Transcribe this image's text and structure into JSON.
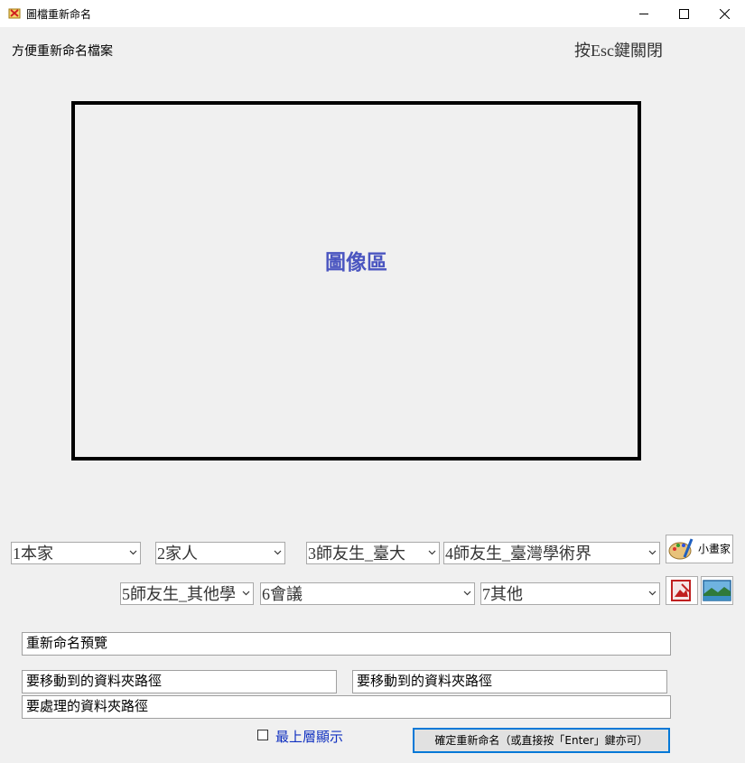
{
  "window": {
    "title": "圖檔重新命名",
    "controls": [
      "minimize-icon",
      "maximize-icon",
      "close-icon"
    ]
  },
  "header": {
    "subtitle": "方便重新命名檔案",
    "esc_hint": "按Esc鍵關閉"
  },
  "image_area": {
    "label": "圖像區"
  },
  "categories": {
    "row1": [
      "1本家",
      "2家人",
      "3師友生_臺大",
      "4師友生_臺灣學術界"
    ],
    "row2": [
      "5師友生_其他學",
      "6會議",
      "7其他"
    ]
  },
  "buttons": {
    "paint_label": "小畫家",
    "confirm_label": "確定重新命名（或直接按「Enter」鍵亦可）"
  },
  "fields": {
    "rename_preview": "重新命名預覽",
    "move_path_1": "要移動到的資料夾路徑",
    "move_path_2": "要移動到的資料夾路徑",
    "process_path": "要處理的資料夾路徑"
  },
  "topmost": {
    "label": "最上層顯示",
    "checked": false
  },
  "colors": {
    "background": "#f0f0f0",
    "image_label": "#4a55c0",
    "link_blue": "#1030c0",
    "focus_border": "#0078d7"
  }
}
